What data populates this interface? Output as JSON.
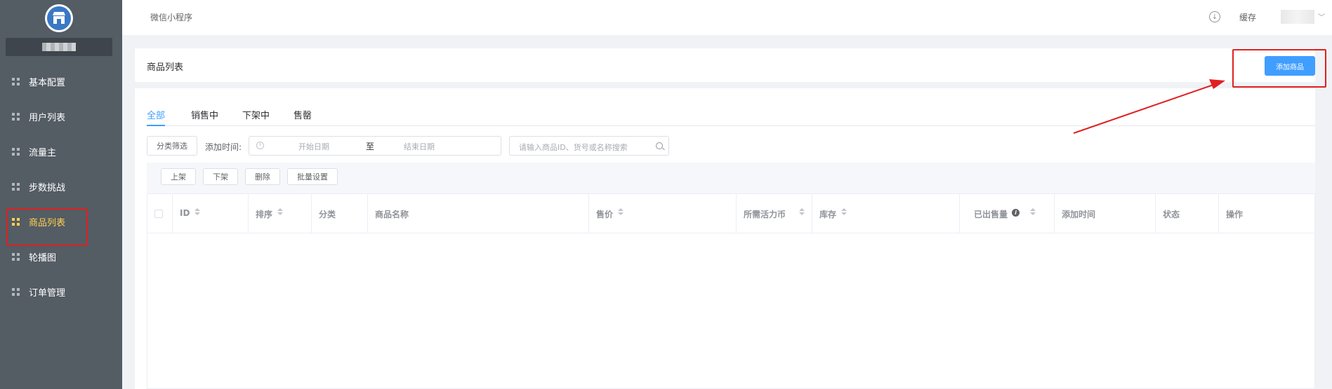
{
  "sidebar": {
    "items": [
      {
        "label": "基本配置",
        "active": false
      },
      {
        "label": "用户列表",
        "active": false
      },
      {
        "label": "流量主",
        "active": false
      },
      {
        "label": "步数挑战",
        "active": false
      },
      {
        "label": "商品列表",
        "active": true
      },
      {
        "label": "轮播图",
        "active": false
      },
      {
        "label": "订单管理",
        "active": false
      }
    ]
  },
  "header": {
    "app_name": "微信小程序",
    "download_icon": "download-icon",
    "cache_label": "缓存"
  },
  "page": {
    "title": "商品列表",
    "add_button": "添加商品"
  },
  "tabs": [
    {
      "label": "全部",
      "active": true
    },
    {
      "label": "销售中",
      "active": false
    },
    {
      "label": "下架中",
      "active": false
    },
    {
      "label": "售罄",
      "active": false
    }
  ],
  "filters": {
    "category_button": "分类筛选",
    "time_label": "添加时间:",
    "start_placeholder": "开始日期",
    "range_separator": "至",
    "end_placeholder": "结束日期",
    "search_placeholder": "请输入商品ID、货号或名称搜索"
  },
  "batch": {
    "on_shelf": "上架",
    "off_shelf": "下架",
    "delete": "删除",
    "batch_settings": "批量设置"
  },
  "table": {
    "columns": [
      {
        "label": "ID",
        "sortable": true
      },
      {
        "label": "排序",
        "sortable": true
      },
      {
        "label": "分类",
        "sortable": false
      },
      {
        "label": "商品名称",
        "sortable": false
      },
      {
        "label": "售价",
        "sortable": true
      },
      {
        "label": "所需活力币",
        "sortable": true
      },
      {
        "label": "库存",
        "sortable": true
      },
      {
        "label": "已出售量",
        "sortable": true,
        "info": true
      },
      {
        "label": "添加时间",
        "sortable": false
      },
      {
        "label": "状态",
        "sortable": false
      },
      {
        "label": "操作",
        "sortable": false
      }
    ],
    "rows": []
  },
  "colors": {
    "sidebar_bg": "#545c64",
    "accent": "#409eff",
    "active_menu": "#ffd04b",
    "annotation": "#e02020"
  }
}
